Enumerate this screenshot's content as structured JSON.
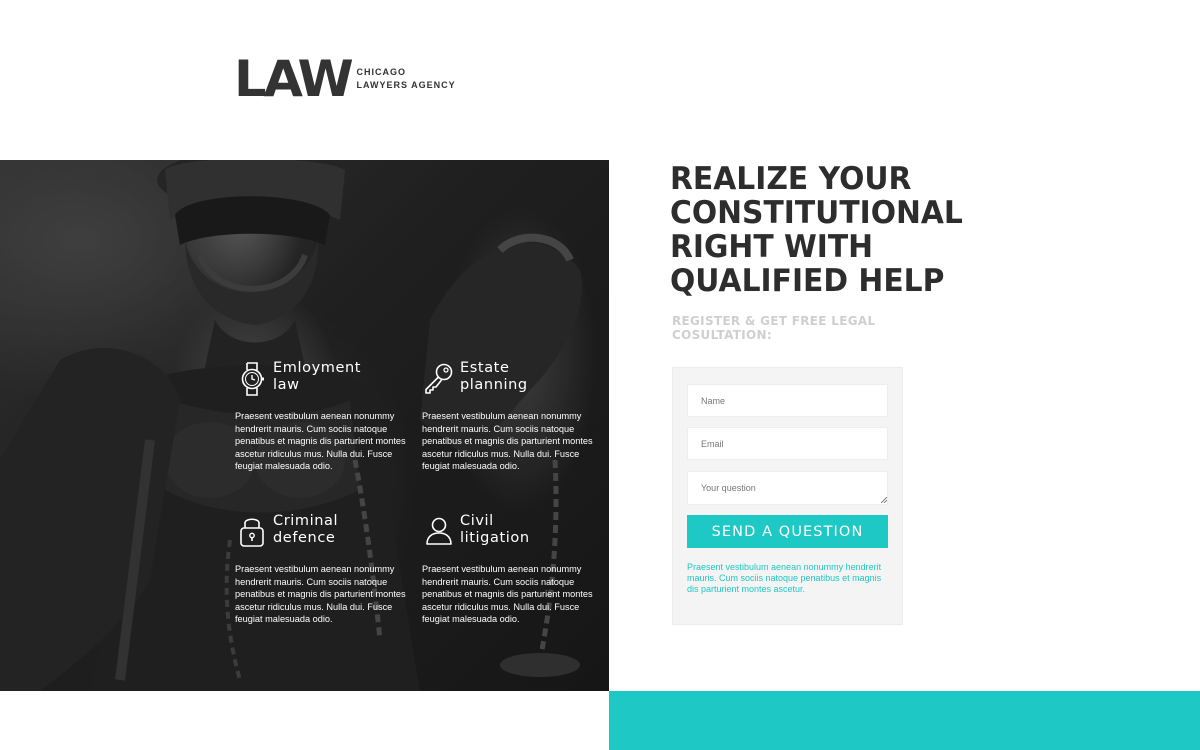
{
  "logo": {
    "mark": "LAW",
    "line1": "CHICAGO",
    "line2": "LAWYERS AGENCY"
  },
  "features": [
    {
      "icon": "watch-icon",
      "title": "Emloyment\nlaw",
      "text": "Praesent vestibulum aenean nonummy hendrerit mauris. Cum sociis natoque penatibus et magnis dis parturient montes ascetur ridiculus mus. Nulla dui. Fusce feugiat malesuada odio."
    },
    {
      "icon": "key-icon",
      "title": "Estate\nplanning",
      "text": "Praesent vestibulum aenean nonummy hendrerit mauris. Cum sociis natoque penatibus et magnis dis parturient montes ascetur ridiculus mus. Nulla dui. Fusce feugiat malesuada odio."
    },
    {
      "icon": "padlock-icon",
      "title": "Criminal\ndefence",
      "text": "Praesent vestibulum aenean nonummy hendrerit mauris. Cum sociis natoque penatibus et magnis dis parturient montes ascetur ridiculus mus. Nulla dui. Fusce feugiat malesuada odio."
    },
    {
      "icon": "person-icon",
      "title": "Civil\nlitigation",
      "text": "Praesent vestibulum aenean nonummy hendrerit mauris. Cum sociis natoque penatibus et magnis dis parturient montes ascetur ridiculus mus. Nulla dui. Fusce feugiat malesuada odio."
    }
  ],
  "headline": {
    "line1": "REALIZE YOUR",
    "line2": "CONSTITUTIONAL",
    "line3": "RIGHT WITH",
    "line4": "QUALIFIED HELP"
  },
  "subheadline": "REGISTER & GET FREE LEGAL COSULTATION:",
  "form": {
    "name_placeholder": "Name",
    "email_placeholder": "Email",
    "question_placeholder": "Your question",
    "submit_label": "SEND A QUESTION",
    "note": "Praesent vestibulum aenean nonummy hendrerit mauris. Cum sociis natoque penatibus et magnis dis parturient montes ascetur."
  },
  "colors": {
    "accent": "#1ec8c4",
    "headline": "#2d2d2d",
    "subheadline": "#cfcfcf",
    "form_background": "#f4f4f4"
  }
}
